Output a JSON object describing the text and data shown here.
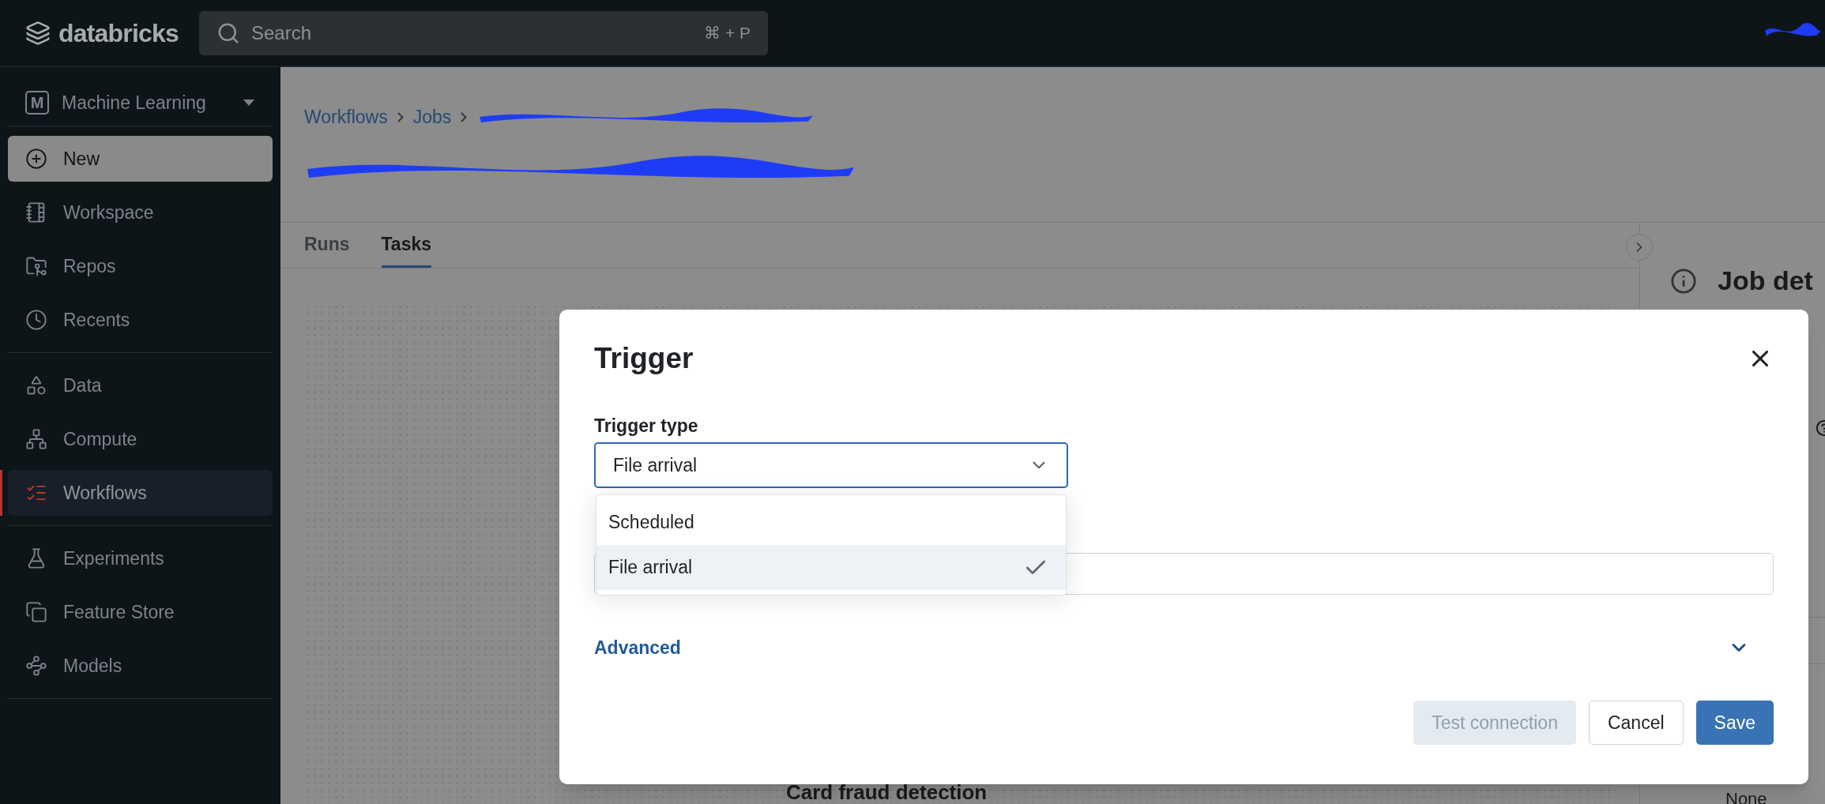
{
  "top_bar": {
    "logo": "databricks",
    "search": {
      "placeholder": "Search",
      "shortcut": "⌘ + P"
    }
  },
  "sidebar": {
    "workspace": {
      "badge": "M",
      "name": "Machine Learning"
    },
    "groups": [
      [
        {
          "label": "New",
          "kind": "new",
          "selected": false
        },
        {
          "label": "Workspace",
          "kind": "item",
          "selected": false
        },
        {
          "label": "Repos",
          "kind": "item",
          "selected": false
        },
        {
          "label": "Recents",
          "kind": "item",
          "selected": false
        }
      ],
      [
        {
          "label": "Data",
          "kind": "item",
          "selected": false
        },
        {
          "label": "Compute",
          "kind": "item",
          "selected": false
        },
        {
          "label": "Workflows",
          "kind": "item",
          "selected": true
        }
      ],
      [
        {
          "label": "Experiments",
          "kind": "item",
          "selected": false
        },
        {
          "label": "Feature Store",
          "kind": "item",
          "selected": false
        },
        {
          "label": "Models",
          "kind": "item",
          "selected": false
        }
      ]
    ]
  },
  "breadcrumb": [
    "Workflows",
    "Jobs"
  ],
  "tabs": [
    {
      "label": "Runs",
      "selected": false
    },
    {
      "label": "Tasks",
      "selected": true
    }
  ],
  "canvas": {
    "task": "Card fraud detection"
  },
  "right_panel": {
    "title": "Job det",
    "value": "None"
  },
  "modal": {
    "title": "Trigger",
    "trigger_type": {
      "label": "Trigger type",
      "value": "File arrival",
      "expanded": true,
      "options": [
        {
          "label": "Scheduled",
          "selected": false
        },
        {
          "label": "File arrival",
          "selected": true
        }
      ]
    },
    "advanced": {
      "label": "Advanced",
      "expanded": false
    },
    "buttons": [
      {
        "label": "Test connection",
        "kind": "secondary",
        "disabled": true
      },
      {
        "label": "Cancel",
        "kind": "default",
        "disabled": false
      },
      {
        "label": "Save",
        "kind": "primary",
        "disabled": false
      }
    ]
  }
}
